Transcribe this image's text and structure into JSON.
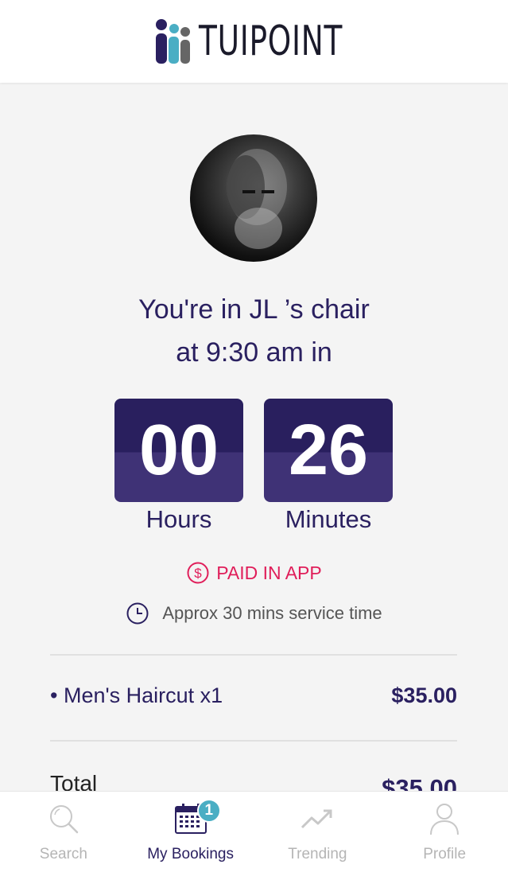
{
  "header": {
    "brand": "TUIPOINT"
  },
  "booking": {
    "headline_line1": "You're in JL ’s chair",
    "headline_line2": "at 9:30 am in",
    "hours_value": "00",
    "minutes_value": "26",
    "hours_label": "Hours",
    "minutes_label": "Minutes",
    "payment_status": "PAID IN APP",
    "service_time": "Approx 30 mins service time"
  },
  "items": [
    {
      "name": "• Men's Haircut x1",
      "price": "$35.00"
    }
  ],
  "total": {
    "label": "Total",
    "value": "$35.00"
  },
  "nav": {
    "items": [
      {
        "label": "Search",
        "icon": "search-icon"
      },
      {
        "label": "My Bookings",
        "icon": "calendar-icon",
        "badge": "1"
      },
      {
        "label": "Trending",
        "icon": "trending-icon"
      },
      {
        "label": "Profile",
        "icon": "user-icon"
      }
    ]
  },
  "colors": {
    "primary": "#2a2060",
    "accent_paid": "#e01e5a",
    "badge": "#4aaec4",
    "tile_top": "#291f5e",
    "tile_bottom": "#3f3276"
  }
}
